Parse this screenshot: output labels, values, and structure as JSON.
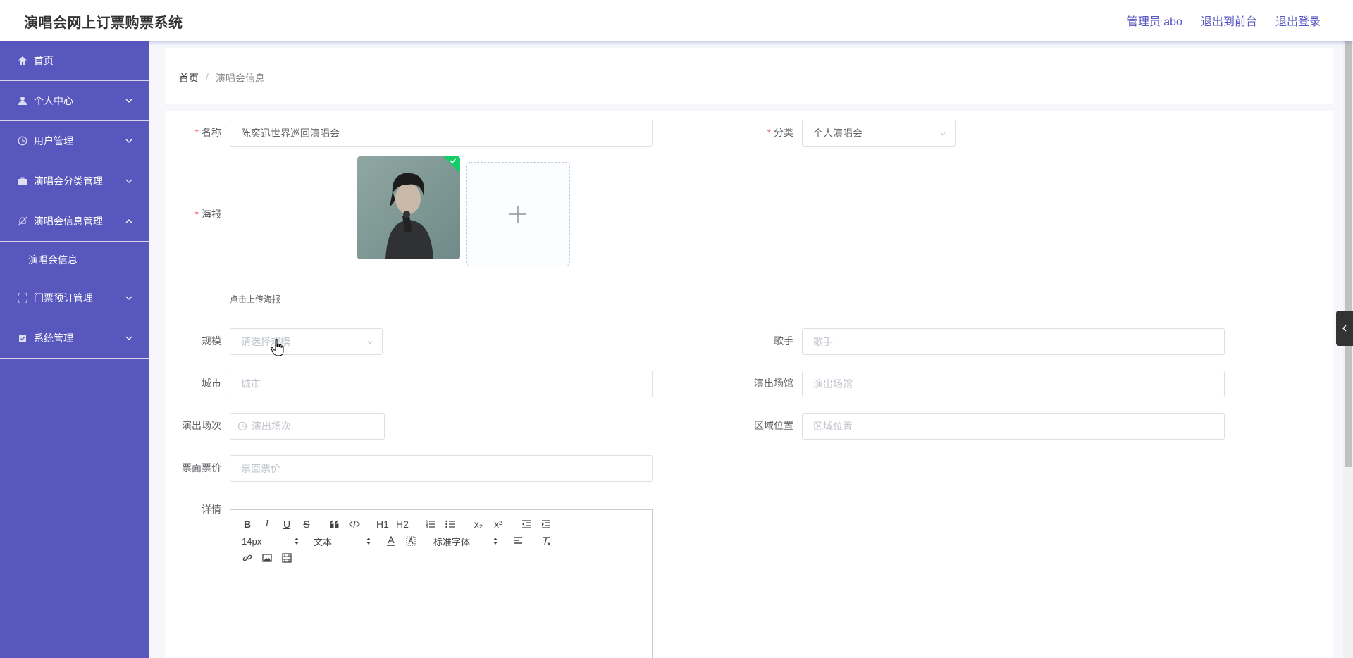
{
  "header": {
    "title": "演唱会网上订票购票系统",
    "admin": "管理员 abo",
    "to_front": "退出到前台",
    "logout": "退出登录"
  },
  "sidebar": {
    "items": [
      {
        "label": "首页",
        "icon": "home-icon"
      },
      {
        "label": "个人中心",
        "icon": "user-icon"
      },
      {
        "label": "用户管理",
        "icon": "clock-icon"
      },
      {
        "label": "演唱会分类管理",
        "icon": "briefcase-icon"
      },
      {
        "label": "演唱会信息管理",
        "icon": "bell-off-icon"
      },
      {
        "label": "门票预订管理",
        "icon": "fullscreen-icon"
      },
      {
        "label": "系统管理",
        "icon": "clipboard-icon"
      }
    ],
    "sub_item": "演唱会信息"
  },
  "breadcrumb": {
    "home": "首页",
    "sep": "/",
    "current": "演唱会信息"
  },
  "form": {
    "name_label": "名称",
    "name_value": "陈奕迅世界巡回演唱会",
    "category_label": "分类",
    "category_value": "个人演唱会",
    "poster_label": "海报",
    "poster_tip": "点击上传海报",
    "scale_label": "规模",
    "scale_placeholder": "请选择规模",
    "singer_label": "歌手",
    "singer_placeholder": "歌手",
    "city_label": "城市",
    "city_placeholder": "城市",
    "venue_label": "演出场馆",
    "venue_placeholder": "演出场馆",
    "session_label": "演出场次",
    "session_placeholder": "演出场次",
    "area_label": "区域位置",
    "area_placeholder": "区域位置",
    "price_label": "票面票价",
    "price_placeholder": "票面票价",
    "detail_label": "详情"
  },
  "editor": {
    "font_size": "14px",
    "format": "文本",
    "font_family": "标准字体",
    "bold": "B",
    "italic": "I",
    "underline": "U",
    "strike": "S",
    "h1": "H1",
    "h2": "H2",
    "sub": "x₂",
    "sup": "x²"
  },
  "colors": {
    "sidebar": "#5757be",
    "required": "#f56c6c"
  }
}
